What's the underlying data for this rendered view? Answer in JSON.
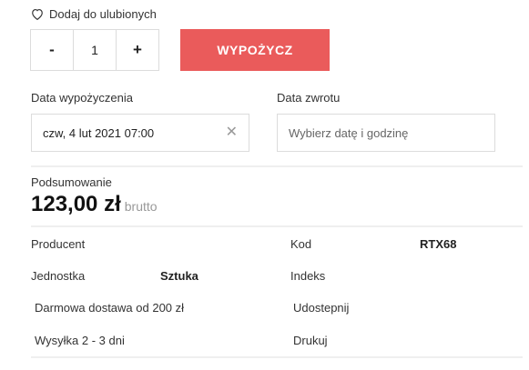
{
  "favorites": {
    "label": "Dodaj do ulubionych"
  },
  "quantity": {
    "minus": "-",
    "value": "1",
    "plus": "+"
  },
  "rent_button": {
    "label": "WYPOŻYCZ"
  },
  "dates": {
    "rental_label": "Data wypożyczenia",
    "rental_value": "czw, 4 lut 2021 07:00",
    "return_label": "Data zwrotu",
    "return_placeholder": "Wybierz datę i godzinę"
  },
  "summary": {
    "label": "Podsumowanie",
    "price": "123,00 zł",
    "price_note": "brutto"
  },
  "details": {
    "producer_label": "Producent",
    "code_label": "Kod",
    "code_value": "RTX68",
    "unit_label": "Jednostka",
    "unit_value": "Sztuka",
    "index_label": "Indeks",
    "free_shipping": "Darmowa dostawa od 200 zł",
    "share": "Udostepnij",
    "shipping": "Wysyłka 2 - 3 dni",
    "print": "Drukuj"
  },
  "colors": {
    "accent": "#ea5b5b",
    "border": "#dcdcdc"
  },
  "icons": {
    "favorite": "heart-icon",
    "clear": "close-icon"
  }
}
